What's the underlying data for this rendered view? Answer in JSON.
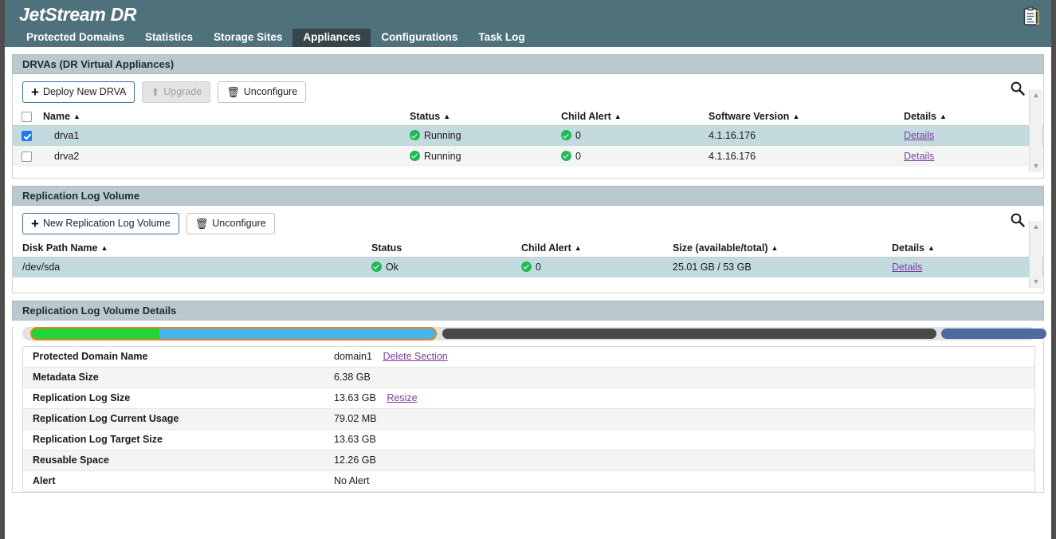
{
  "app": {
    "brand": "JetStream DR",
    "header_icon": "clipboard-icon",
    "tabs": [
      {
        "label": "Protected Domains",
        "active": false
      },
      {
        "label": "Statistics",
        "active": false
      },
      {
        "label": "Storage Sites",
        "active": false
      },
      {
        "label": "Appliances",
        "active": true
      },
      {
        "label": "Configurations",
        "active": false
      },
      {
        "label": "Task Log",
        "active": false
      }
    ]
  },
  "drvas_panel": {
    "title": "DRVAs (DR Virtual Appliances)",
    "toolbar": {
      "deploy_label": "Deploy New DRVA",
      "upgrade_label": "Upgrade",
      "unconfigure_label": "Unconfigure",
      "search_icon": "search-icon"
    },
    "columns": [
      "Name",
      "Status",
      "Child Alert",
      "Software Version",
      "Details"
    ],
    "rows": [
      {
        "checked": true,
        "name": "drva1",
        "status": "Running",
        "child_alert": "0",
        "software_version": "4.1.16.176",
        "details": "Details"
      },
      {
        "checked": false,
        "name": "drva2",
        "status": "Running",
        "child_alert": "0",
        "software_version": "4.1.16.176",
        "details": "Details"
      }
    ]
  },
  "rlv_panel": {
    "title": "Replication Log Volume",
    "toolbar": {
      "new_label": "New Replication Log Volume",
      "unconfigure_label": "Unconfigure",
      "search_icon": "search-icon"
    },
    "columns": [
      "Disk Path Name",
      "Status",
      "Child Alert",
      "Size (available/total)",
      "Details"
    ],
    "rows": [
      {
        "disk_path_name": "/dev/sda",
        "status": "Ok",
        "child_alert": "0",
        "size": "25.01 GB / 53 GB",
        "details": "Details"
      }
    ]
  },
  "details_panel": {
    "title": "Replication Log Volume Details",
    "usage_bar": {
      "segments": [
        {
          "name": "used-metadata",
          "color": "#21d43a",
          "percent": 13.0
        },
        {
          "name": "used-replication-log",
          "color": "#45b6ef",
          "percent": 26.6
        },
        {
          "name": "free-space",
          "color": "#4a4a4a",
          "percent": 48.9
        },
        {
          "name": "reserved",
          "color": "#4f6a9e",
          "percent": 10.5
        }
      ],
      "outline_color": "#f07f1a"
    },
    "rows": [
      {
        "label": "Protected Domain Name",
        "value": "domain1",
        "link": "Delete Section"
      },
      {
        "label": "Metadata Size",
        "value": "6.38 GB",
        "link": ""
      },
      {
        "label": "Replication Log Size",
        "value": "13.63 GB",
        "link": "Resize"
      },
      {
        "label": "Replication Log Current Usage",
        "value": "79.02 MB",
        "link": ""
      },
      {
        "label": "Replication Log Target Size",
        "value": "13.63 GB",
        "link": ""
      },
      {
        "label": "Reusable Space",
        "value": "12.26 GB",
        "link": ""
      },
      {
        "label": "Alert",
        "value": "No Alert",
        "link": ""
      }
    ]
  }
}
